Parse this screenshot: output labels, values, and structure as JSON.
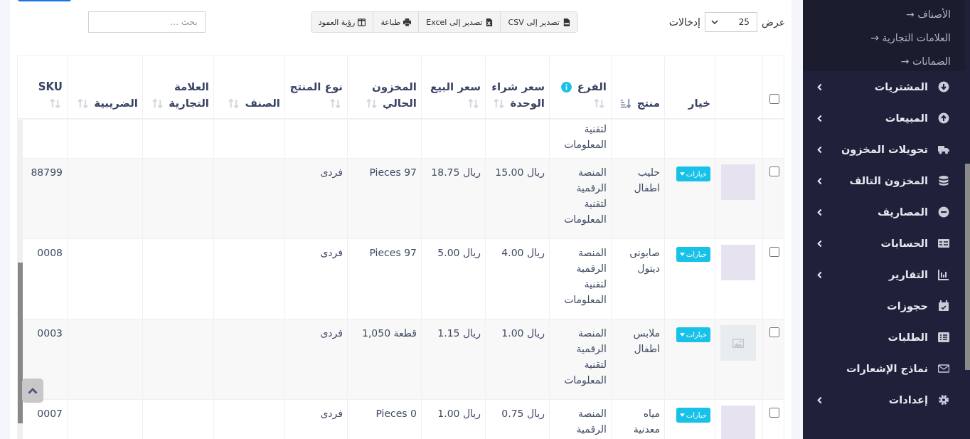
{
  "length_menu": {
    "label_before": "عرض",
    "value": "25",
    "label_after": "إدخالات"
  },
  "export_buttons": [
    {
      "label": "تصدير إلى CSV"
    },
    {
      "label": "تصدير إلى Excel"
    },
    {
      "label": "طباعة"
    },
    {
      "label": "رؤية العمود"
    }
  ],
  "search": {
    "placeholder": "بحث ..."
  },
  "table": {
    "columns": [
      {
        "kind": "checkbox",
        "checked": false
      },
      {
        "kind": "blank"
      },
      {
        "kind": "text",
        "label": "خيار"
      },
      {
        "kind": "text",
        "label": "منتج",
        "sorted": true
      },
      {
        "kind": "text",
        "label": "الفرع",
        "sorted": false,
        "info": true
      },
      {
        "kind": "text",
        "label": "سعر شراء الوحدة",
        "sorted": false
      },
      {
        "kind": "text",
        "label": "سعر البيع",
        "sorted": false
      },
      {
        "kind": "text",
        "label": "المخزون الحالي",
        "sorted": false
      },
      {
        "kind": "text",
        "label": "نوع المنتج",
        "sorted": false
      },
      {
        "kind": "text",
        "label": "الصنف",
        "sorted": false
      },
      {
        "kind": "text",
        "label": "العلامة التجارية",
        "sorted": false
      },
      {
        "kind": "text",
        "label": "الضريبية",
        "sorted": false
      },
      {
        "kind": "text",
        "label": "SKU",
        "sorted": false
      }
    ],
    "partial_row": {
      "branch": "لتقنية المعلومات"
    },
    "rows": [
      {
        "checked": false,
        "kind": "photo",
        "options": "خيارات",
        "product": "حليب اطفال",
        "branch": "المنصة الرقمية لتقنية المعلومات",
        "unit_cost": "ريال 15.00",
        "price": "ريال 18.75",
        "stock": "97 Pieces",
        "product_type": "فردى",
        "sku": "88799"
      },
      {
        "checked": false,
        "kind": "photo",
        "options": "خيارات",
        "product": "صابونى ديتول",
        "branch": "المنصة الرقمية لتقنية المعلومات",
        "unit_cost": "ريال 4.00",
        "price": "ريال 5.00",
        "stock": "97 Pieces",
        "product_type": "فردى",
        "sku": "0008"
      },
      {
        "checked": false,
        "kind": "placeholder",
        "options": "خيارات",
        "product": "ملابس اطفال",
        "branch": "المنصة الرقمية لتقنية المعلومات",
        "unit_cost": "ريال 1.00",
        "price": "ريال 1.15",
        "stock": "قطعة 1,050",
        "product_type": "فردى",
        "sku": "0003"
      },
      {
        "checked": false,
        "kind": "photo",
        "options": "خيارات",
        "product": "مياه معدنية",
        "branch": "المنصة الرقمية",
        "unit_cost": "ريال 0.75",
        "price": "ريال 1.00",
        "stock": "0 Pieces",
        "product_type": "فردى",
        "sku": "0007"
      }
    ]
  },
  "sidebar": {
    "submenu": [
      {
        "arrow": "→",
        "label": "الأصناف"
      },
      {
        "arrow": "→",
        "label": "العلامات التجارية"
      },
      {
        "arrow": "→",
        "label": "الضمانات"
      }
    ],
    "items": [
      {
        "label": "المشتريات",
        "expandable": true
      },
      {
        "label": "المبيعات",
        "expandable": true
      },
      {
        "label": "تحويلات المخزون",
        "expandable": true
      },
      {
        "label": "المخزون التالف",
        "expandable": true
      },
      {
        "label": "المصاريف",
        "expandable": true
      },
      {
        "label": "الحسابات",
        "expandable": true
      },
      {
        "label": "التقارير",
        "expandable": true
      },
      {
        "label": "حجوزات",
        "expandable": false
      },
      {
        "label": "الطلبات",
        "expandable": false
      },
      {
        "label": "نماذج الإشعارات",
        "expandable": false
      },
      {
        "label": "إعدادات",
        "expandable": true
      }
    ]
  }
}
